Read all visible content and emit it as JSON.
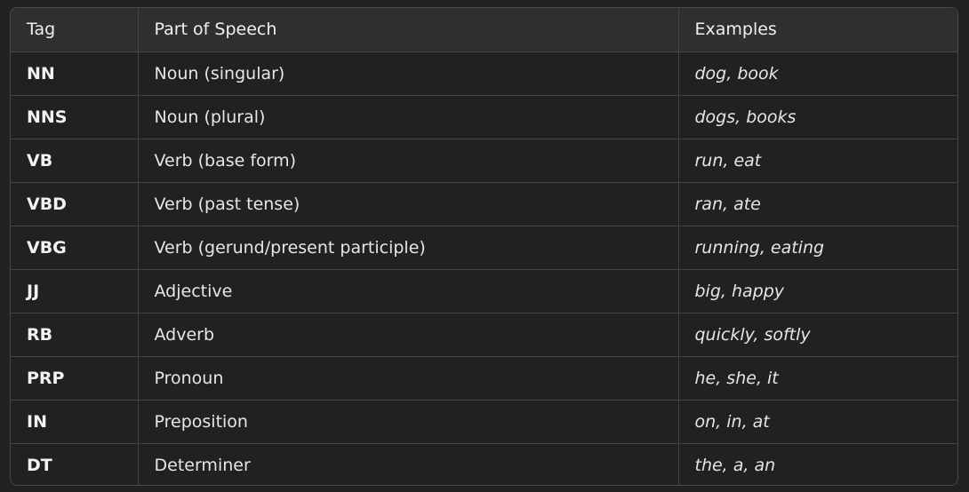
{
  "headers": {
    "tag": "Tag",
    "pos": "Part of Speech",
    "examples": "Examples"
  },
  "rows": [
    {
      "tag": "NN",
      "pos": "Noun (singular)",
      "examples": "dog, book"
    },
    {
      "tag": "NNS",
      "pos": "Noun (plural)",
      "examples": "dogs, books"
    },
    {
      "tag": "VB",
      "pos": "Verb (base form)",
      "examples": "run, eat"
    },
    {
      "tag": "VBD",
      "pos": "Verb (past tense)",
      "examples": "ran, ate"
    },
    {
      "tag": "VBG",
      "pos": "Verb (gerund/present participle)",
      "examples": "running, eating"
    },
    {
      "tag": "JJ",
      "pos": "Adjective",
      "examples": "big, happy"
    },
    {
      "tag": "RB",
      "pos": "Adverb",
      "examples": "quickly, softly"
    },
    {
      "tag": "PRP",
      "pos": "Pronoun",
      "examples": "he, she, it"
    },
    {
      "tag": "IN",
      "pos": "Preposition",
      "examples": "on, in, at"
    },
    {
      "tag": "DT",
      "pos": "Determiner",
      "examples": "the, a, an"
    }
  ]
}
